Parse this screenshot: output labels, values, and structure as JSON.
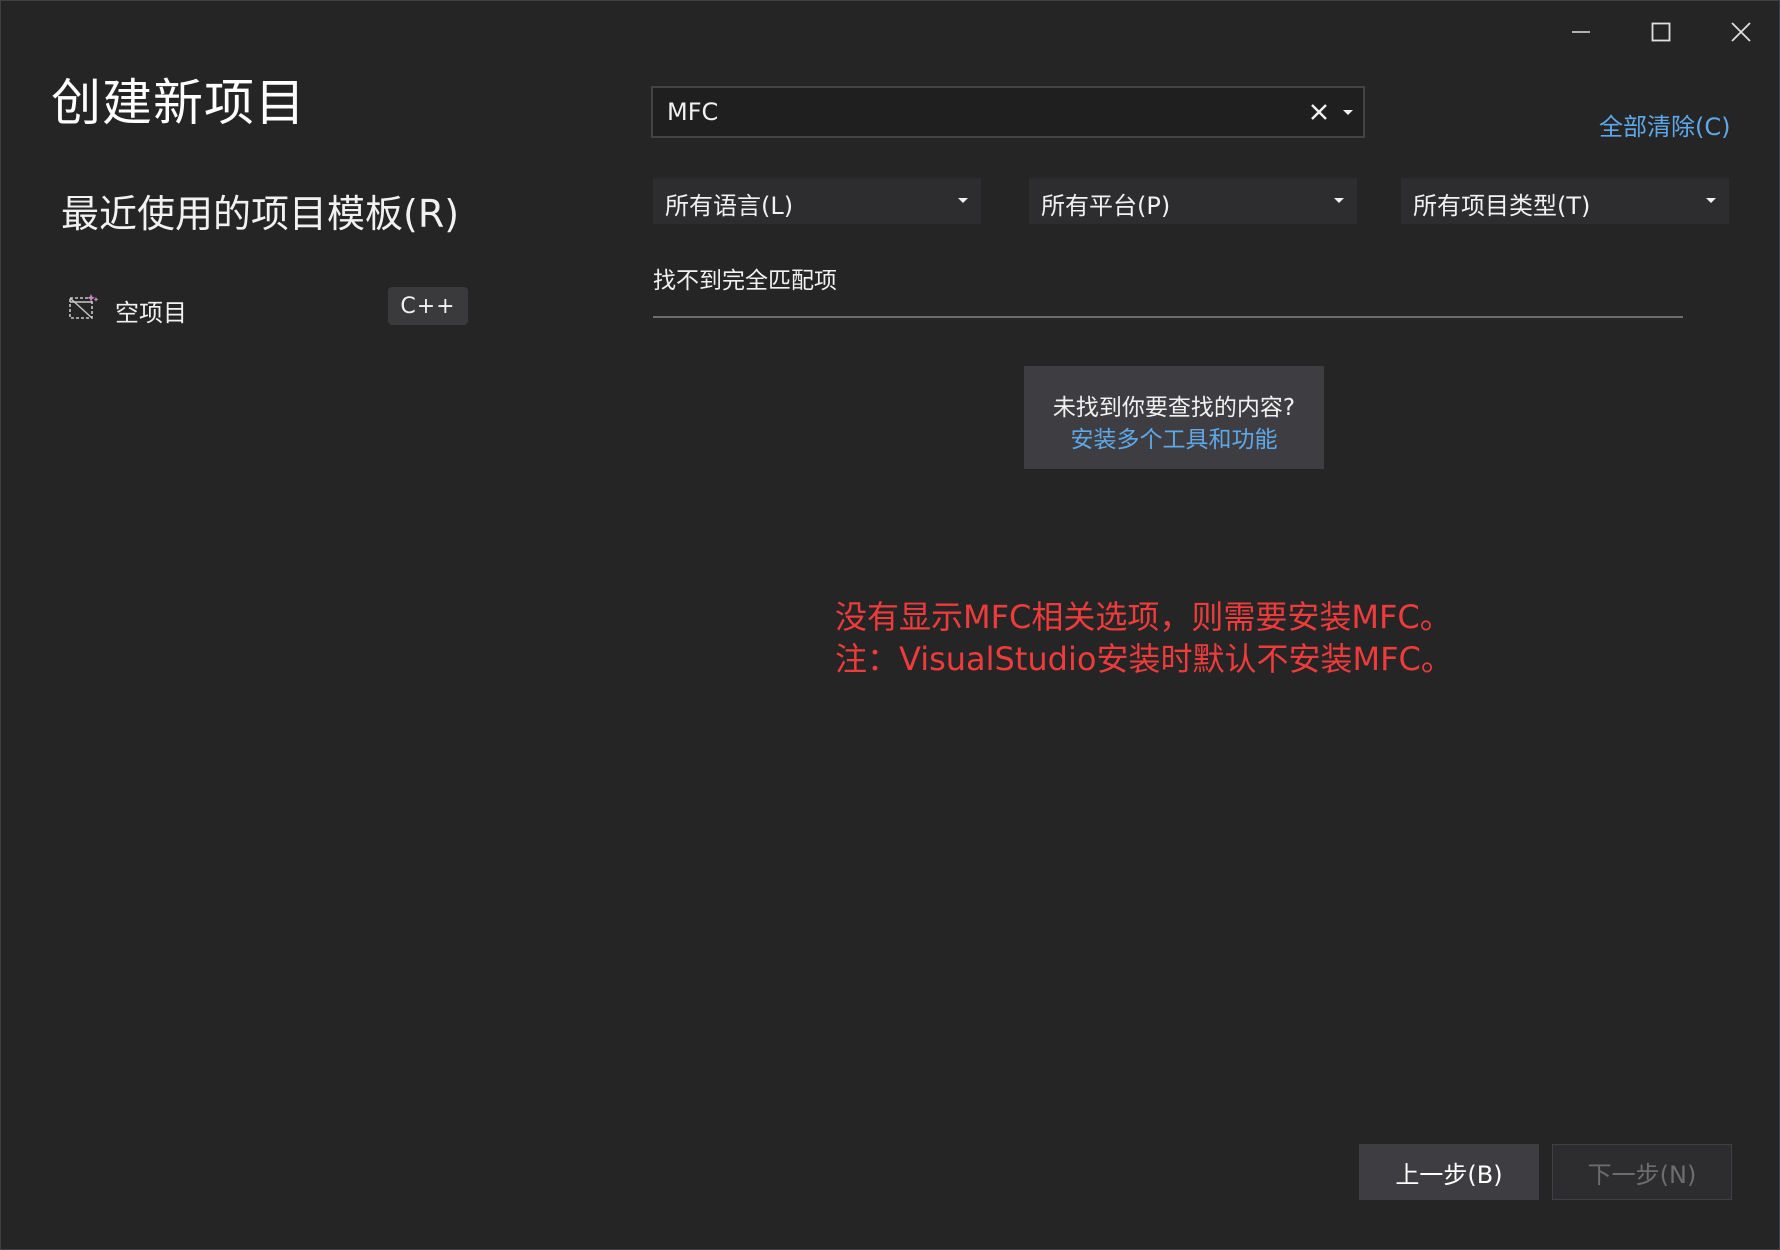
{
  "window": {
    "title": "创建新项目",
    "controls": {
      "minimize_icon": "minimize-icon",
      "maximize_icon": "maximize-icon",
      "close_icon": "close-icon"
    }
  },
  "sidebar": {
    "recent_title": "最近使用的项目模板(R)",
    "recent_items": [
      {
        "name": "空项目",
        "language": "C++",
        "icon": "empty-project-icon"
      }
    ]
  },
  "search": {
    "value": "MFC",
    "placeholder": ""
  },
  "clear_all": "全部清除(C)",
  "filters": {
    "language": "所有语言(L)",
    "platform": "所有平台(P)",
    "project_type": "所有项目类型(T)"
  },
  "results": {
    "no_match": "找不到完全匹配项"
  },
  "help": {
    "question": "未找到你要查找的内容?",
    "link": "安装多个工具和功能"
  },
  "annotation": {
    "line1": "没有显示MFC相关选项，则需要安装MFC。",
    "line2": "注：VisualStudio安装时默认不安装MFC。"
  },
  "footer": {
    "back_label": "上一步(B)",
    "next_label": "下一步(N)"
  },
  "colors": {
    "background": "#252526",
    "link": "#5fa8e8",
    "annotation": "#ef3b3b"
  }
}
